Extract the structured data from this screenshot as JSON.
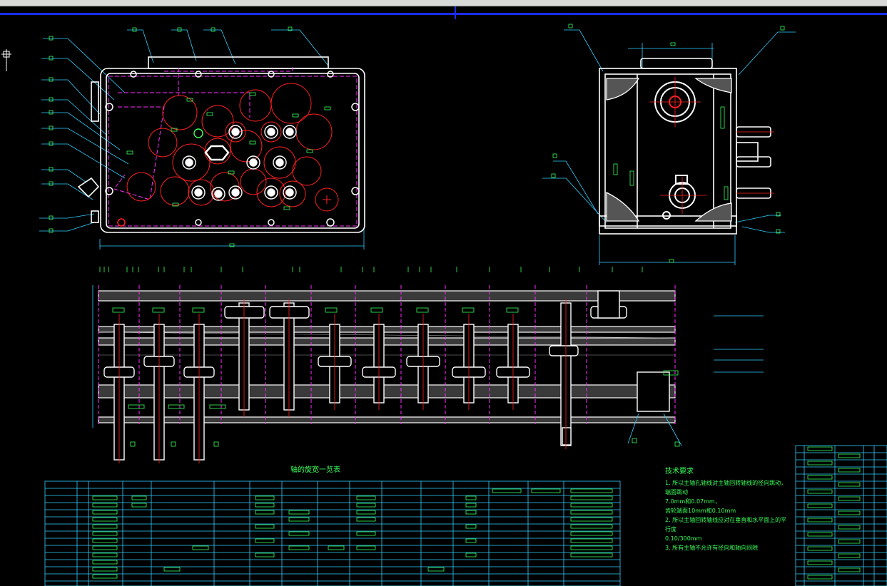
{
  "colors": {
    "white": "#ffffff",
    "red": "#ff2020",
    "magenta": "#ff2aff",
    "green": "#39ff5a",
    "cyan": "#2fd0ff",
    "blue": "#1a2cff"
  },
  "spindle_table": {
    "title": "轴的旋宽一览表"
  },
  "technical_requirements": {
    "title": "技术要求",
    "items": [
      "1. 所以主轴孔轴线对主轴回转轴线的径向跳动，端面跳动",
      "7.0mm和0.07mm，",
      "齿轮端面10mm和0.10mm",
      "2. 所以主轴回转轴线应对在垂直和水平面上的平行度",
      "0.10/300mm",
      "3. 所有主轴不允许有径向和轴向间隙"
    ]
  }
}
